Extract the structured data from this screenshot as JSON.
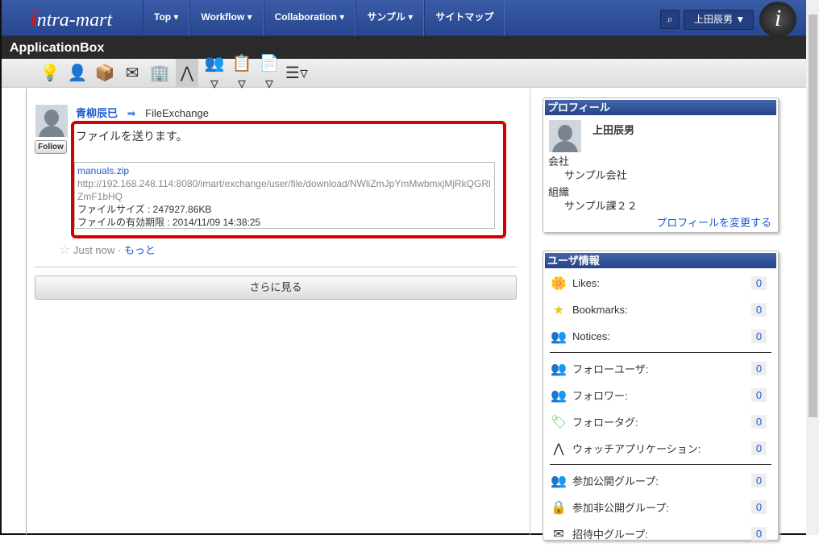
{
  "header": {
    "logo": "intra-mart",
    "nav": [
      "Top ▾",
      "Workflow ▾",
      "Collaboration ▾",
      "サンプル ▾",
      "サイトマップ"
    ],
    "user": "上田辰男",
    "search_icon": "search-icon"
  },
  "title_bar": "ApplicationBox",
  "post": {
    "author": "青柳辰巳",
    "target": "FileExchange",
    "follow": "Follow",
    "message": "ファイルを送ります。",
    "file_name": "manuals.zip",
    "file_url": "http://192.168.248.114:8080/imart/exchange/user/file/download/NWliZmJpYmMwbmxjMjRkQGRlZmF1bHQ",
    "file_size": "ファイルサイズ : 247927.86KB",
    "expiry": "ファイルの有効期限 : 2014/11/09 14:38:25",
    "time": "Just now",
    "sep": "·",
    "more": "もっと"
  },
  "see_more": "さらに見る",
  "profile": {
    "title": "プロフィール",
    "name": "上田辰男",
    "company_label": "会社",
    "company": "サンプル会社",
    "org_label": "組織",
    "org": "サンプル課２２",
    "edit": "プロフィールを変更する"
  },
  "user_info": {
    "title": "ユーザ情報",
    "items": [
      {
        "label": "Likes:",
        "count": "0"
      },
      {
        "label": "Bookmarks:",
        "count": "0"
      },
      {
        "label": "Notices:",
        "count": "0"
      },
      {
        "label": "フォローユーザ:",
        "count": "0"
      },
      {
        "label": "フォロワー:",
        "count": "0"
      },
      {
        "label": "フォロータグ:",
        "count": "0"
      },
      {
        "label": "ウォッチアプリケーション:",
        "count": "0"
      },
      {
        "label": "参加公開グループ:",
        "count": "0"
      },
      {
        "label": "参加非公開グループ:",
        "count": "0"
      },
      {
        "label": "招待中グループ:",
        "count": "0"
      }
    ]
  }
}
